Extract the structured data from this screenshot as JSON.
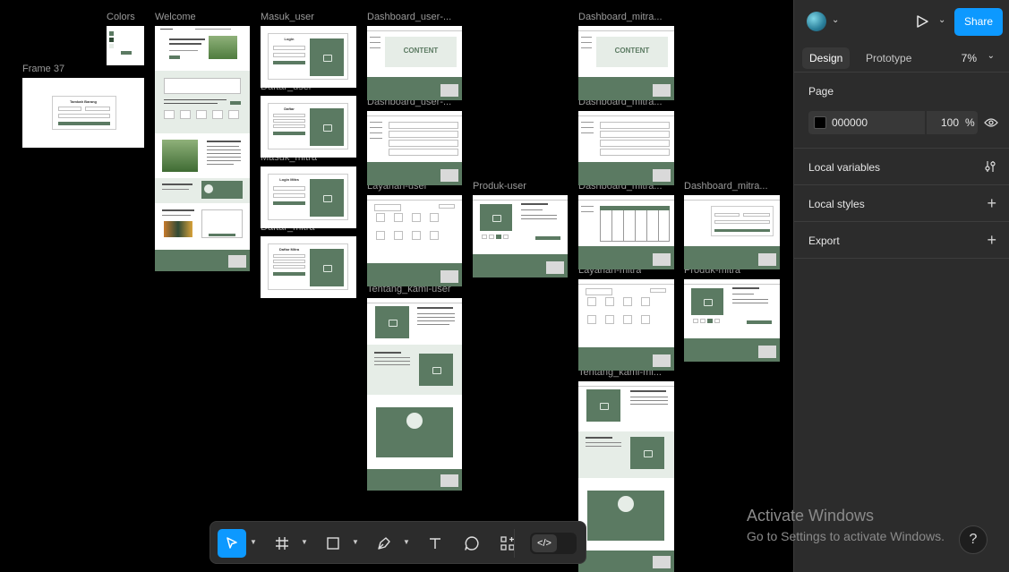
{
  "canvas": {
    "frames": [
      {
        "id": "colors",
        "label": "Colors"
      },
      {
        "id": "welcome",
        "label": "Welcome"
      },
      {
        "id": "frame37",
        "label": "Frame 37",
        "title": "Tambah Barang"
      },
      {
        "id": "masuk_user",
        "label": "Masuk_user",
        "title": "Login"
      },
      {
        "id": "daftar_user",
        "label": "Daftar_user",
        "title": "Daftar"
      },
      {
        "id": "masuk_mitra",
        "label": "Masuk_mitra",
        "title": "Login Mitra"
      },
      {
        "id": "daftar_mitra",
        "label": "Daftar_mitra",
        "title": "Daftar Mitra"
      },
      {
        "id": "dash_user_1",
        "label": "Dashboard_user-...",
        "content": "CONTENT"
      },
      {
        "id": "dash_user_2",
        "label": "Dashboard_user-..."
      },
      {
        "id": "layanan_user",
        "label": "Layanan-user"
      },
      {
        "id": "produk_user",
        "label": "Produk-user"
      },
      {
        "id": "tentang_user",
        "label": "Tentang_kami-user"
      },
      {
        "id": "dash_mitra_1",
        "label": "Dashboard_mitra...",
        "content": "CONTENT"
      },
      {
        "id": "dash_mitra_2",
        "label": "Dashboard_mitra..."
      },
      {
        "id": "dash_mitra_3",
        "label": "Dashboard_mitra..."
      },
      {
        "id": "dash_mitra_4",
        "label": "Dashboard_mitra..."
      },
      {
        "id": "layanan_mitra",
        "label": "Layanan-mitra"
      },
      {
        "id": "produk_mitra",
        "label": "Produk-mitra"
      },
      {
        "id": "tentang_mitra",
        "label": "Tentang_kami-mi..."
      }
    ]
  },
  "panel": {
    "share_label": "Share",
    "tabs": [
      {
        "label": "Design"
      },
      {
        "label": "Prototype"
      }
    ],
    "zoom": "7%",
    "page": {
      "title": "Page",
      "color_hex": "000000",
      "opacity": "100",
      "pct": "%"
    },
    "sections": [
      {
        "label": "Local variables"
      },
      {
        "label": "Local styles"
      },
      {
        "label": "Export"
      }
    ]
  },
  "toolbar": {
    "tools": [
      "move-tool",
      "frame-tool",
      "shape-tool",
      "pen-tool",
      "text-tool",
      "comment-tool",
      "actions-tool"
    ],
    "dev_mode": "</>"
  },
  "overlay": {
    "activate_title": "Activate Windows",
    "activate_sub": "Go to Settings to activate Windows.",
    "help": "?"
  },
  "colors": {
    "accent": "#0d99ff",
    "brand_green": "#5b7a62",
    "panel_bg": "#2c2c2c",
    "canvas_bg": "#000000"
  }
}
